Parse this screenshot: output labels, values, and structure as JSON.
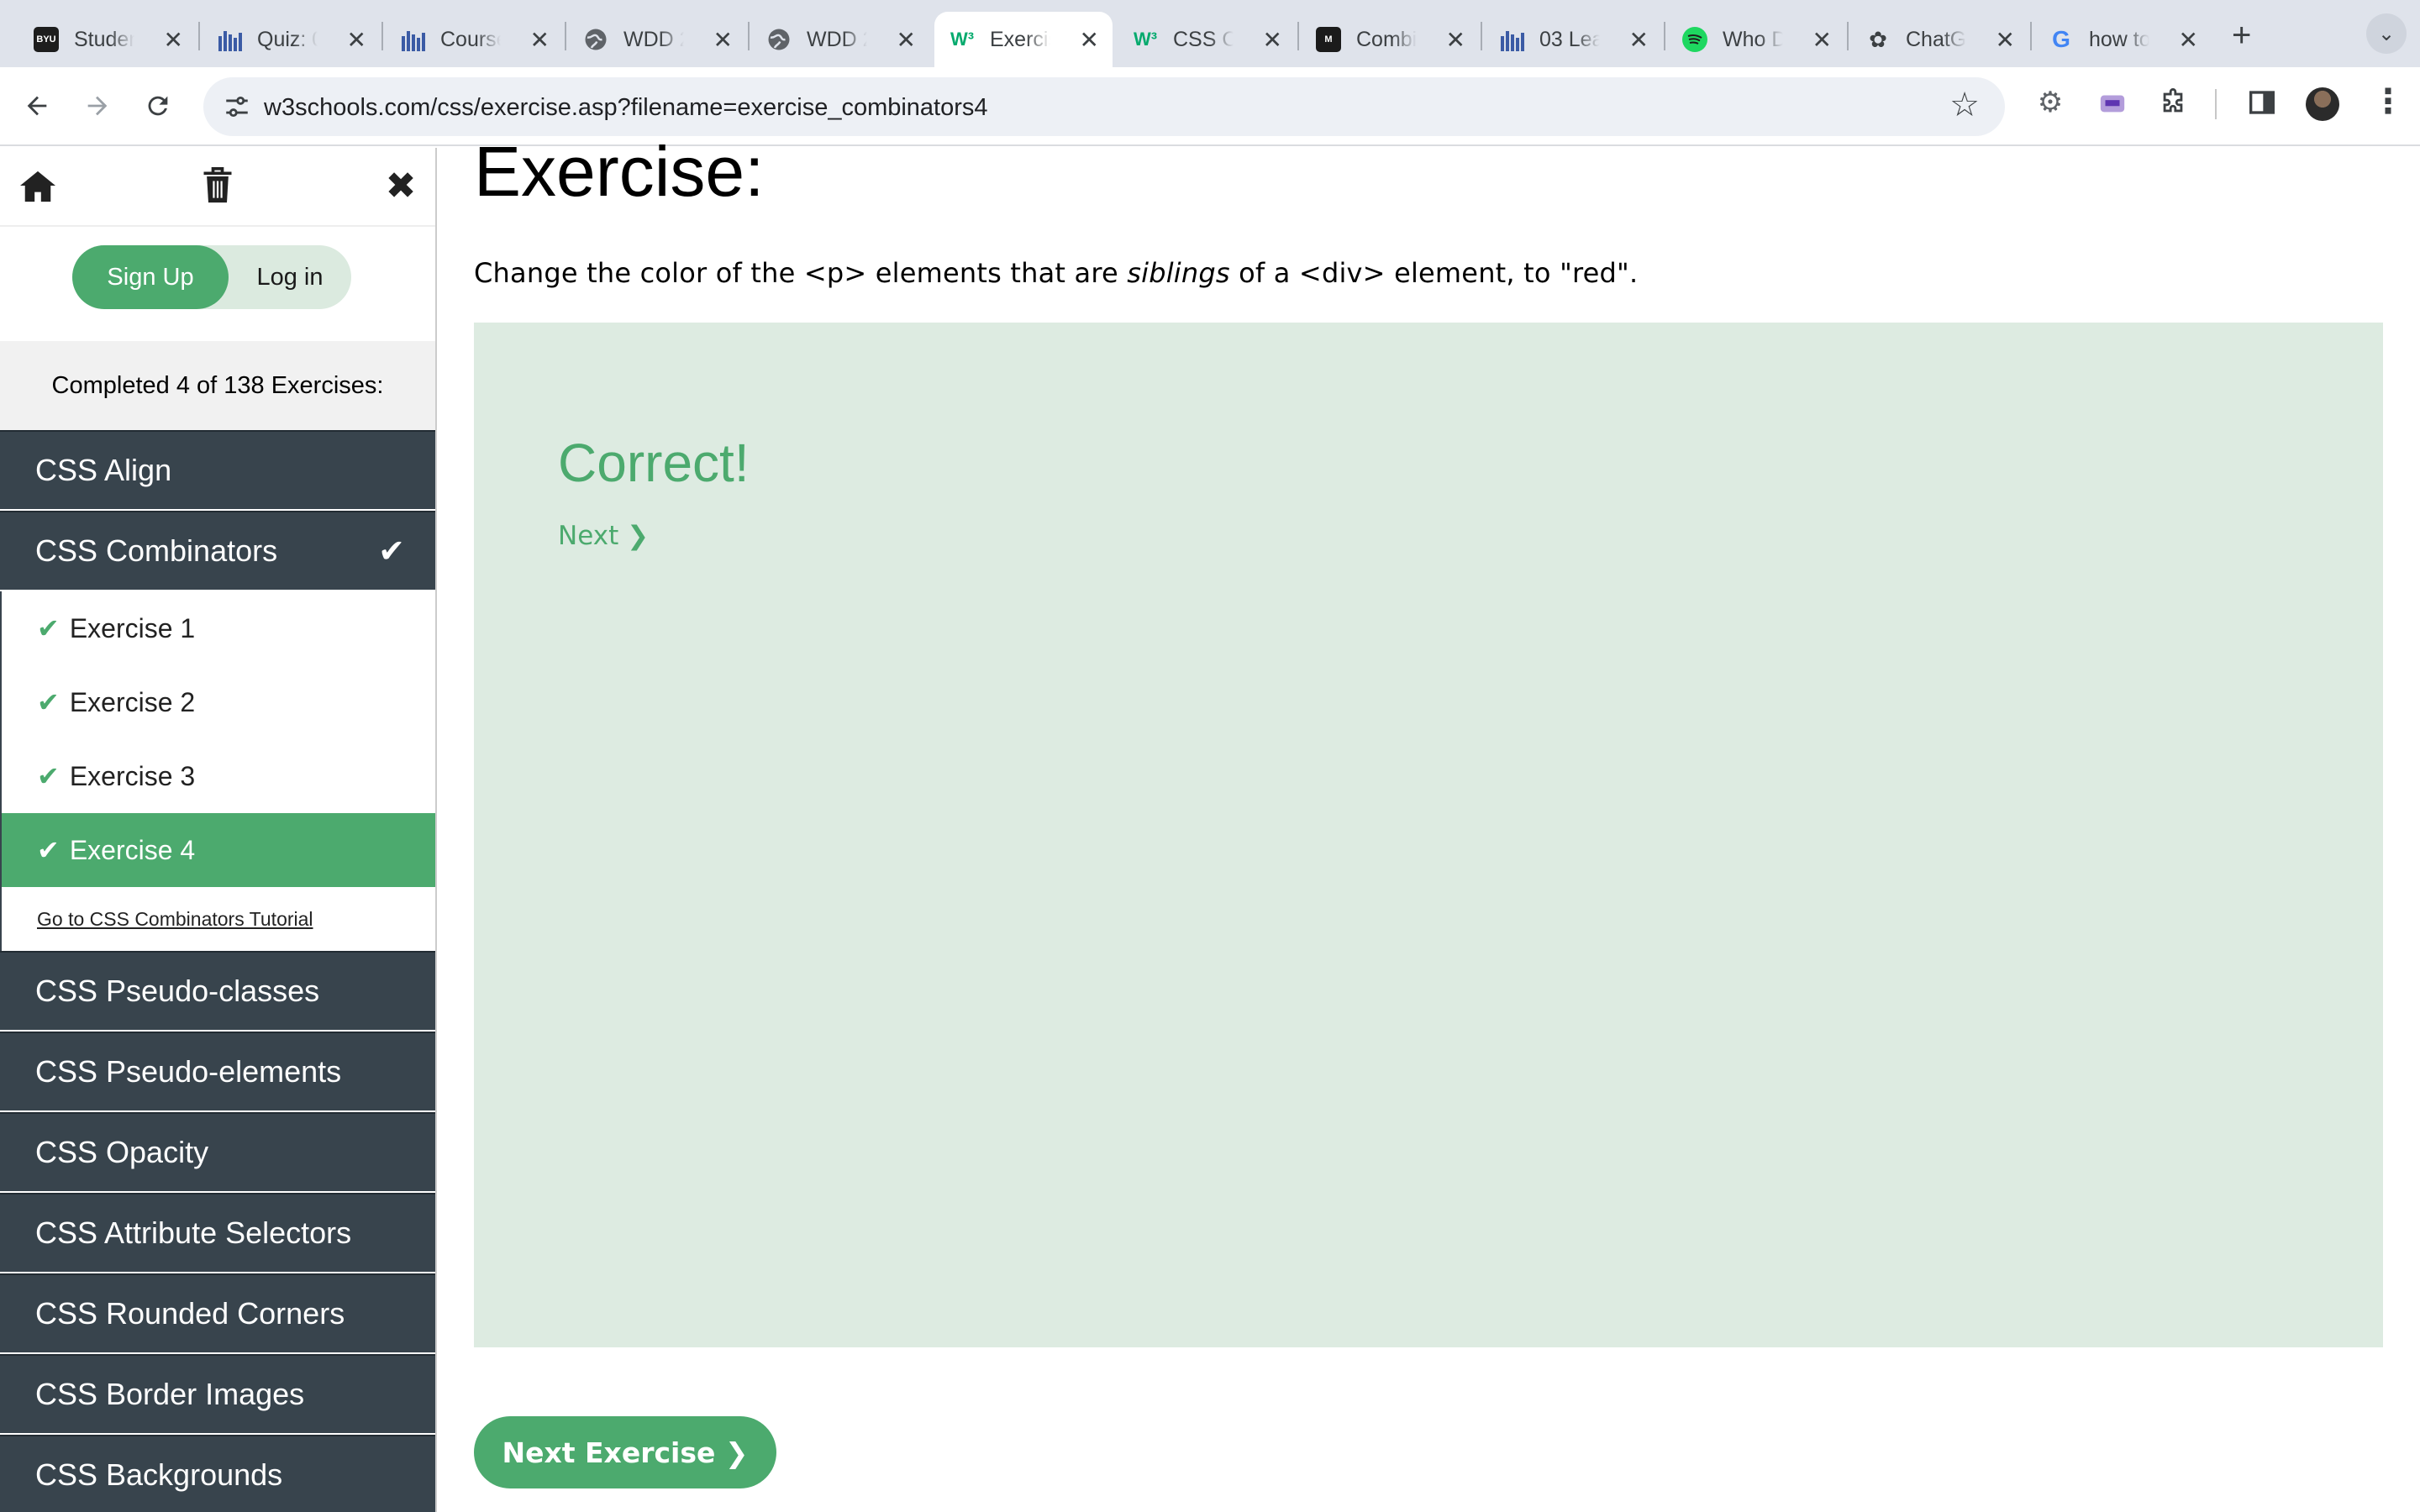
{
  "browser": {
    "tabs": [
      {
        "title": "Studen",
        "icon": "byu-icon",
        "active": false
      },
      {
        "title": "Quiz: 0",
        "icon": "canvas-icon",
        "active": false
      },
      {
        "title": "Course",
        "icon": "canvas-icon",
        "active": false
      },
      {
        "title": "WDD 2",
        "icon": "globe-icon",
        "active": false
      },
      {
        "title": "WDD 2",
        "icon": "globe-icon",
        "active": false
      },
      {
        "title": "Exercis",
        "icon": "w3schools-icon",
        "active": true
      },
      {
        "title": "CSS Co",
        "icon": "w3schools-icon",
        "active": false
      },
      {
        "title": "Combi",
        "icon": "mdn-icon",
        "active": false
      },
      {
        "title": "03 Lea",
        "icon": "canvas-icon",
        "active": false
      },
      {
        "title": "Who D",
        "icon": "spotify-icon",
        "active": false
      },
      {
        "title": "ChatGI",
        "icon": "chatgpt-icon",
        "active": false
      },
      {
        "title": "how to",
        "icon": "google-icon",
        "active": false
      }
    ],
    "url": "w3schools.com/css/exercise.asp?filename=exercise_combinators4",
    "accent": "#04AA6D"
  },
  "sidebar": {
    "signup_label": "Sign Up",
    "login_label": "Log in",
    "progress_text": "Completed 4 of 138 Exercises:",
    "categories_before": [
      {
        "label": "CSS Align"
      }
    ],
    "open_category": {
      "label": "CSS Combinators"
    },
    "exercises": [
      {
        "label": "Exercise 1",
        "done": true
      },
      {
        "label": "Exercise 2",
        "done": true
      },
      {
        "label": "Exercise 3",
        "done": true
      },
      {
        "label": "Exercise 4",
        "done": true,
        "active": true
      }
    ],
    "tutorial_link": "Go to CSS Combinators Tutorial",
    "categories_after": [
      {
        "label": "CSS Pseudo-classes"
      },
      {
        "label": "CSS Pseudo-elements"
      },
      {
        "label": "CSS Opacity"
      },
      {
        "label": "CSS Attribute Selectors"
      },
      {
        "label": "CSS Rounded Corners"
      },
      {
        "label": "CSS Border Images"
      },
      {
        "label": "CSS Backgrounds"
      }
    ]
  },
  "main": {
    "heading": "Exercise:",
    "instruction_pre": "Change the color of the <p> elements that are ",
    "instruction_em": "siblings",
    "instruction_post": " of a <div> element, to \"red\".",
    "result_title": "Correct!",
    "next_link": "Next ❯",
    "next_exercise_button": "Next Exercise ❯"
  }
}
